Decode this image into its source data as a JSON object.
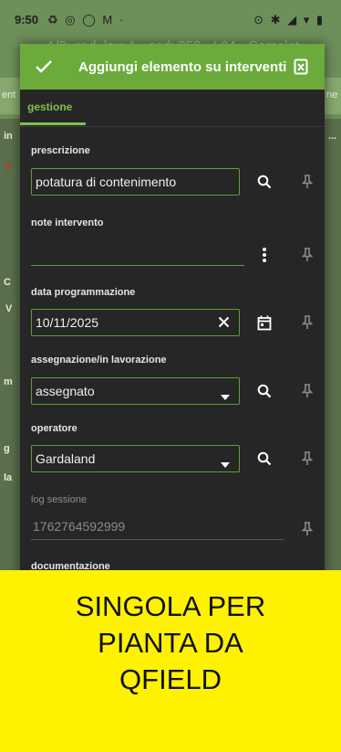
{
  "status_bar": {
    "time": "9:50",
    "left_icons": "♻ ◎ ◯ M ·",
    "right_icons": "⊙ ✱ ◢ ▾ ▮",
    "behind_title": "1/2: cod_lav: 1 - cod: 259 - L04 - Camelot -"
  },
  "dialog": {
    "title": "Aggiungi elemento su interventi",
    "tab": "gestione",
    "fields": {
      "prescrizione": {
        "label": "prescrizione",
        "value": "potatura di contenimento"
      },
      "note": {
        "label": "note intervento",
        "value": ""
      },
      "data": {
        "label": "data programmazione",
        "value": "10/11/2025"
      },
      "assegnazione": {
        "label": "assegnazione/in lavorazione",
        "value": "assegnato"
      },
      "operatore": {
        "label": "operatore",
        "value": "Gardaland"
      },
      "log": {
        "label": "log sessione",
        "value": "1762764592999"
      },
      "documentazione": {
        "label": "documentazione"
      }
    }
  },
  "background_letters": [
    "ent",
    "in",
    "p",
    "C",
    "V",
    "m",
    "g",
    "la",
    "ne",
    "..."
  ],
  "banner": {
    "line1": "SINGOLA PER",
    "line2": "PIANTA DA",
    "line3": "QFIELD"
  },
  "colors": {
    "accent": "#6bab3c",
    "tab_accent": "#7fc24a",
    "banner": "#fff200",
    "dialog_bg": "#262626"
  }
}
